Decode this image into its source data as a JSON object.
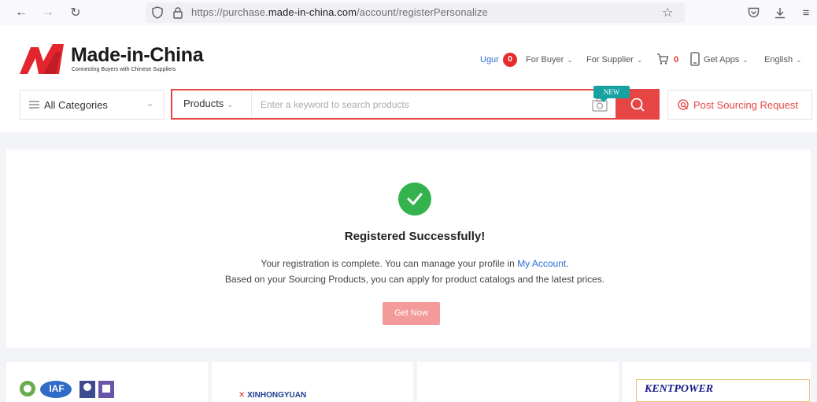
{
  "browser": {
    "url_prefix": "https://purchase.",
    "url_host": "made-in-china.com",
    "url_path": "/account/registerPersonalize"
  },
  "header": {
    "logo_text": "Made-in-China",
    "logo_tagline": "Connecting Buyers with Chinese Suppliers",
    "user_name": "Ugur",
    "user_badge": "0",
    "for_buyer": "For Buyer",
    "for_supplier": "For Supplier",
    "cart_count": "0",
    "get_apps": "Get Apps",
    "language": "English"
  },
  "search": {
    "categories_label": "All Categories",
    "type_label": "Products",
    "placeholder": "Enter a keyword to search products",
    "new_tag": "NEW",
    "post_sourcing_label": "Post Sourcing Request"
  },
  "main": {
    "title": "Registered Successfully!",
    "line1_text": "Your registration is complete. You can manage your profile in",
    "line1_link": "My Account",
    "line1_end": ".",
    "line2_text": "Based on your Sourcing Products, you can apply for product catalogs and the latest prices.",
    "button_label": "Get Now"
  },
  "strip": {
    "cert_label": "IAF",
    "xin_brand": "XINHONGYUAN",
    "kent_brand": "KENTPOWER"
  },
  "colors": {
    "brand_red": "#e64545",
    "success_green": "#33b24d",
    "link_blue": "#2a6fd6"
  }
}
